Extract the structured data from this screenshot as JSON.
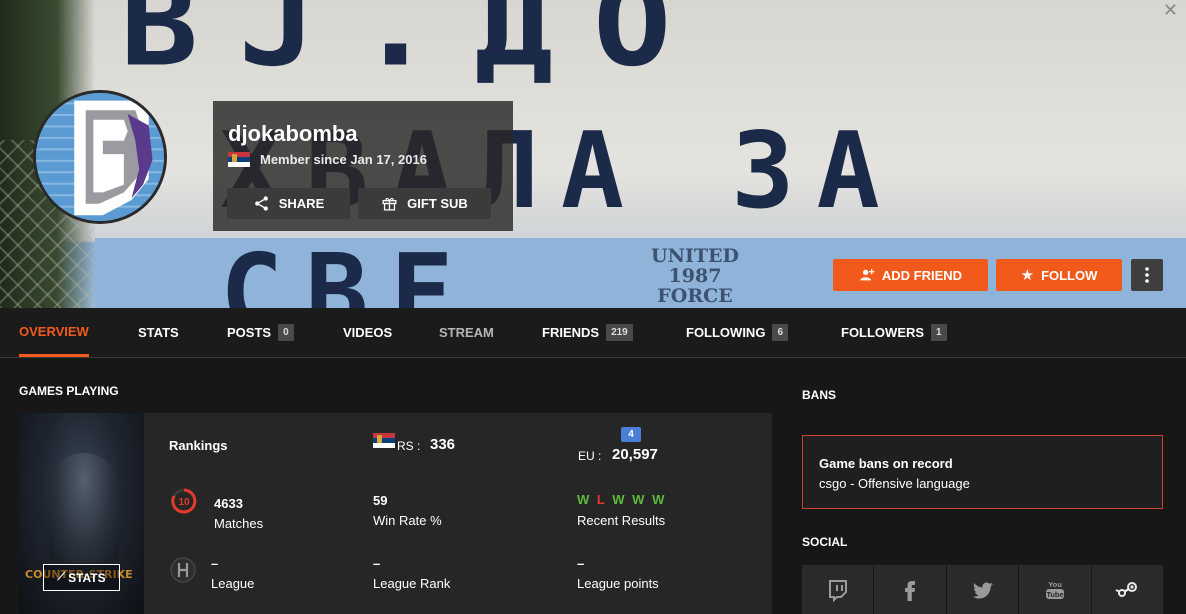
{
  "profile": {
    "username": "djokabomba",
    "member_since": "Member since Jan 17, 2016",
    "share_label": "SHARE",
    "gift_label": "GIFT SUB"
  },
  "actions": {
    "add_friend_label": "ADD FRIEND",
    "follow_label": "FOLLOW"
  },
  "banner": {
    "graffiti_line1": "ВЈ.ДО",
    "graffiti_line2": "ХВАЛА ЗА СВЕ",
    "stencil": [
      "UNITED",
      "1987",
      "FORCE"
    ]
  },
  "nav": {
    "tabs": [
      {
        "label": "OVERVIEW",
        "count": null
      },
      {
        "label": "STATS",
        "count": null
      },
      {
        "label": "POSTS",
        "count": "0"
      },
      {
        "label": "VIDEOS",
        "count": null
      },
      {
        "label": "STREAM",
        "count": null
      },
      {
        "label": "FRIENDS",
        "count": "219"
      },
      {
        "label": "FOLLOWING",
        "count": "6"
      },
      {
        "label": "FOLLOWERS",
        "count": "1"
      }
    ]
  },
  "games": {
    "title": "GAMES PLAYING",
    "cover_logo": "COUNTER-STRIKE",
    "stats_label": "STATS",
    "rankings_label": "Rankings",
    "rs_label": "RS :",
    "rs_value": "336",
    "eu_label": "EU :",
    "eu_value": "20,597",
    "region_badge": "4",
    "level_value": "10",
    "matches_value": "4633",
    "matches_label": "Matches",
    "winrate_value": "59",
    "winrate_label": "Win Rate %",
    "recent_results": [
      "W",
      "L",
      "W",
      "W",
      "W"
    ],
    "recent_label": "Recent Results",
    "league_value": "–",
    "league_label": "League",
    "league_rank_value": "–",
    "league_rank_label": "League Rank",
    "league_points_value": "–",
    "league_points_label": "League points"
  },
  "bans": {
    "title": "BANS",
    "box_title": "Game bans on record",
    "detail": "csgo - Offensive language"
  },
  "social": {
    "title": "SOCIAL",
    "icons": [
      "twitch-icon",
      "facebook-icon",
      "twitter-icon",
      "youtube-icon",
      "steam-icon"
    ]
  },
  "colors": {
    "accent": "#f25a1c",
    "win": "#5dba3c",
    "loss": "#e33a2b",
    "ban_border": "#c9432f"
  }
}
